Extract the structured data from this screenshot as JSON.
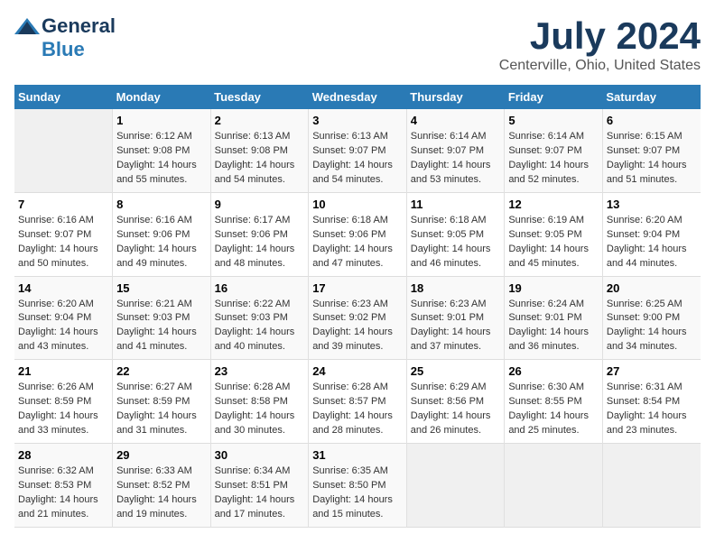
{
  "logo": {
    "line1": "General",
    "line2": "Blue"
  },
  "title": "July 2024",
  "subtitle": "Centerville, Ohio, United States",
  "days_of_week": [
    "Sunday",
    "Monday",
    "Tuesday",
    "Wednesday",
    "Thursday",
    "Friday",
    "Saturday"
  ],
  "weeks": [
    [
      {
        "day": "",
        "sunrise": "",
        "sunset": "",
        "daylight": ""
      },
      {
        "day": "1",
        "sunrise": "Sunrise: 6:12 AM",
        "sunset": "Sunset: 9:08 PM",
        "daylight": "Daylight: 14 hours and 55 minutes."
      },
      {
        "day": "2",
        "sunrise": "Sunrise: 6:13 AM",
        "sunset": "Sunset: 9:08 PM",
        "daylight": "Daylight: 14 hours and 54 minutes."
      },
      {
        "day": "3",
        "sunrise": "Sunrise: 6:13 AM",
        "sunset": "Sunset: 9:07 PM",
        "daylight": "Daylight: 14 hours and 54 minutes."
      },
      {
        "day": "4",
        "sunrise": "Sunrise: 6:14 AM",
        "sunset": "Sunset: 9:07 PM",
        "daylight": "Daylight: 14 hours and 53 minutes."
      },
      {
        "day": "5",
        "sunrise": "Sunrise: 6:14 AM",
        "sunset": "Sunset: 9:07 PM",
        "daylight": "Daylight: 14 hours and 52 minutes."
      },
      {
        "day": "6",
        "sunrise": "Sunrise: 6:15 AM",
        "sunset": "Sunset: 9:07 PM",
        "daylight": "Daylight: 14 hours and 51 minutes."
      }
    ],
    [
      {
        "day": "7",
        "sunrise": "Sunrise: 6:16 AM",
        "sunset": "Sunset: 9:07 PM",
        "daylight": "Daylight: 14 hours and 50 minutes."
      },
      {
        "day": "8",
        "sunrise": "Sunrise: 6:16 AM",
        "sunset": "Sunset: 9:06 PM",
        "daylight": "Daylight: 14 hours and 49 minutes."
      },
      {
        "day": "9",
        "sunrise": "Sunrise: 6:17 AM",
        "sunset": "Sunset: 9:06 PM",
        "daylight": "Daylight: 14 hours and 48 minutes."
      },
      {
        "day": "10",
        "sunrise": "Sunrise: 6:18 AM",
        "sunset": "Sunset: 9:06 PM",
        "daylight": "Daylight: 14 hours and 47 minutes."
      },
      {
        "day": "11",
        "sunrise": "Sunrise: 6:18 AM",
        "sunset": "Sunset: 9:05 PM",
        "daylight": "Daylight: 14 hours and 46 minutes."
      },
      {
        "day": "12",
        "sunrise": "Sunrise: 6:19 AM",
        "sunset": "Sunset: 9:05 PM",
        "daylight": "Daylight: 14 hours and 45 minutes."
      },
      {
        "day": "13",
        "sunrise": "Sunrise: 6:20 AM",
        "sunset": "Sunset: 9:04 PM",
        "daylight": "Daylight: 14 hours and 44 minutes."
      }
    ],
    [
      {
        "day": "14",
        "sunrise": "Sunrise: 6:20 AM",
        "sunset": "Sunset: 9:04 PM",
        "daylight": "Daylight: 14 hours and 43 minutes."
      },
      {
        "day": "15",
        "sunrise": "Sunrise: 6:21 AM",
        "sunset": "Sunset: 9:03 PM",
        "daylight": "Daylight: 14 hours and 41 minutes."
      },
      {
        "day": "16",
        "sunrise": "Sunrise: 6:22 AM",
        "sunset": "Sunset: 9:03 PM",
        "daylight": "Daylight: 14 hours and 40 minutes."
      },
      {
        "day": "17",
        "sunrise": "Sunrise: 6:23 AM",
        "sunset": "Sunset: 9:02 PM",
        "daylight": "Daylight: 14 hours and 39 minutes."
      },
      {
        "day": "18",
        "sunrise": "Sunrise: 6:23 AM",
        "sunset": "Sunset: 9:01 PM",
        "daylight": "Daylight: 14 hours and 37 minutes."
      },
      {
        "day": "19",
        "sunrise": "Sunrise: 6:24 AM",
        "sunset": "Sunset: 9:01 PM",
        "daylight": "Daylight: 14 hours and 36 minutes."
      },
      {
        "day": "20",
        "sunrise": "Sunrise: 6:25 AM",
        "sunset": "Sunset: 9:00 PM",
        "daylight": "Daylight: 14 hours and 34 minutes."
      }
    ],
    [
      {
        "day": "21",
        "sunrise": "Sunrise: 6:26 AM",
        "sunset": "Sunset: 8:59 PM",
        "daylight": "Daylight: 14 hours and 33 minutes."
      },
      {
        "day": "22",
        "sunrise": "Sunrise: 6:27 AM",
        "sunset": "Sunset: 8:59 PM",
        "daylight": "Daylight: 14 hours and 31 minutes."
      },
      {
        "day": "23",
        "sunrise": "Sunrise: 6:28 AM",
        "sunset": "Sunset: 8:58 PM",
        "daylight": "Daylight: 14 hours and 30 minutes."
      },
      {
        "day": "24",
        "sunrise": "Sunrise: 6:28 AM",
        "sunset": "Sunset: 8:57 PM",
        "daylight": "Daylight: 14 hours and 28 minutes."
      },
      {
        "day": "25",
        "sunrise": "Sunrise: 6:29 AM",
        "sunset": "Sunset: 8:56 PM",
        "daylight": "Daylight: 14 hours and 26 minutes."
      },
      {
        "day": "26",
        "sunrise": "Sunrise: 6:30 AM",
        "sunset": "Sunset: 8:55 PM",
        "daylight": "Daylight: 14 hours and 25 minutes."
      },
      {
        "day": "27",
        "sunrise": "Sunrise: 6:31 AM",
        "sunset": "Sunset: 8:54 PM",
        "daylight": "Daylight: 14 hours and 23 minutes."
      }
    ],
    [
      {
        "day": "28",
        "sunrise": "Sunrise: 6:32 AM",
        "sunset": "Sunset: 8:53 PM",
        "daylight": "Daylight: 14 hours and 21 minutes."
      },
      {
        "day": "29",
        "sunrise": "Sunrise: 6:33 AM",
        "sunset": "Sunset: 8:52 PM",
        "daylight": "Daylight: 14 hours and 19 minutes."
      },
      {
        "day": "30",
        "sunrise": "Sunrise: 6:34 AM",
        "sunset": "Sunset: 8:51 PM",
        "daylight": "Daylight: 14 hours and 17 minutes."
      },
      {
        "day": "31",
        "sunrise": "Sunrise: 6:35 AM",
        "sunset": "Sunset: 8:50 PM",
        "daylight": "Daylight: 14 hours and 15 minutes."
      },
      {
        "day": "",
        "sunrise": "",
        "sunset": "",
        "daylight": ""
      },
      {
        "day": "",
        "sunrise": "",
        "sunset": "",
        "daylight": ""
      },
      {
        "day": "",
        "sunrise": "",
        "sunset": "",
        "daylight": ""
      }
    ]
  ]
}
